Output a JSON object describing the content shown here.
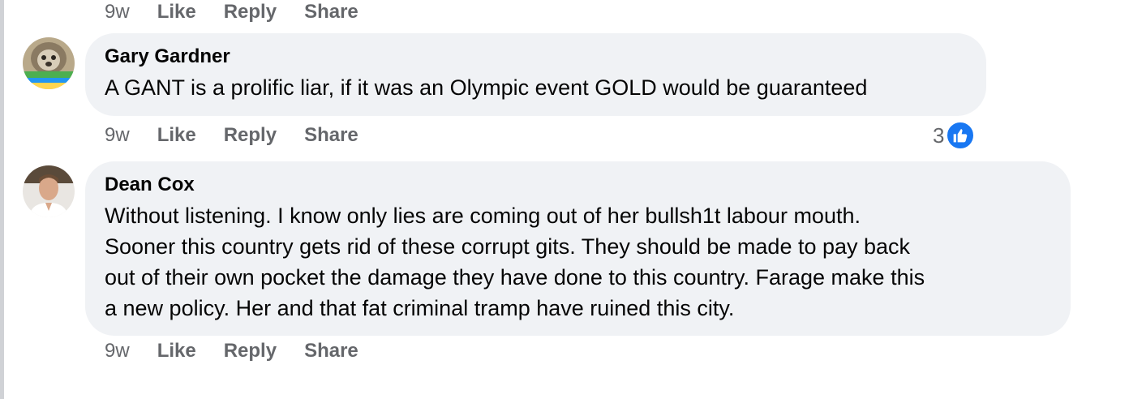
{
  "top_actions": {
    "time": "9w",
    "like": "Like",
    "reply": "Reply",
    "share": "Share"
  },
  "comments": [
    {
      "author": "Gary Gardner",
      "text": "A GANT is a prolific liar, if it was an Olympic event GOLD would be guaranteed",
      "time": "9w",
      "like": "Like",
      "reply": "Reply",
      "share": "Share",
      "reaction_count": "3",
      "reaction_icon": "thumbs-up-icon",
      "reaction_color": "#1877f2"
    },
    {
      "author": "Dean Cox",
      "text": "Without listening. I know only lies are coming out of her bullsh1t labour mouth.\nSooner this country gets rid of these corrupt gits. They should be made to pay back\nout of their own pocket the damage they have done to this country. Farage make this\na new policy. Her and that fat criminal tramp have ruined this city.",
      "time": "9w",
      "like": "Like",
      "reply": "Reply",
      "share": "Share"
    }
  ],
  "colors": {
    "bubble_bg": "#f0f2f5",
    "meta_text": "#65676b",
    "primary_text": "#050505",
    "like_blue": "#1877f2"
  }
}
